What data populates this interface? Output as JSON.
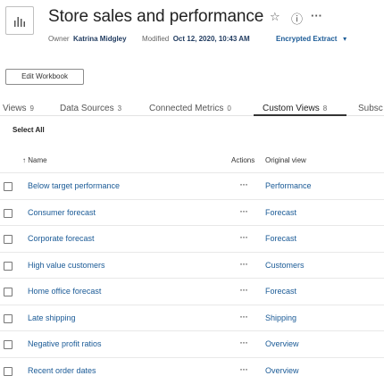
{
  "header": {
    "title": "Store sales and performance",
    "owner_label": "Owner",
    "owner": "Katrina Midgley",
    "modified_label": "Modified",
    "modified": "Oct 12, 2020, 10:43 AM",
    "extract": "Encrypted Extract",
    "favorite_glyph": "☆",
    "info_glyph": "ⓘ",
    "more_glyph": "···",
    "dropdown_glyph": "▾"
  },
  "toolbar": {
    "edit_label": "Edit Workbook"
  },
  "tabs": [
    {
      "label": "Views",
      "count": "9"
    },
    {
      "label": "Data Sources",
      "count": "3"
    },
    {
      "label": "Connected Metrics",
      "count": "0"
    },
    {
      "label": "Custom Views",
      "count": "8"
    },
    {
      "label": "Subsc",
      "count": ""
    }
  ],
  "active_tab": "Custom Views",
  "list": {
    "select_all": "Select All",
    "columns": {
      "name": "↑ Name",
      "actions": "Actions",
      "original_view": "Original view"
    },
    "actions_glyph": "···",
    "rows": [
      {
        "name": "Below target performance",
        "view": "Performance"
      },
      {
        "name": "Consumer forecast",
        "view": "Forecast"
      },
      {
        "name": "Corporate forecast",
        "view": "Forecast"
      },
      {
        "name": "High value customers",
        "view": "Customers"
      },
      {
        "name": "Home office forecast",
        "view": "Forecast"
      },
      {
        "name": "Late shipping",
        "view": "Shipping"
      },
      {
        "name": "Negative profit ratios",
        "view": "Overview"
      },
      {
        "name": "Recent order dates",
        "view": "Overview"
      }
    ]
  },
  "colors": {
    "link": "#1a5a96",
    "text": "#333333",
    "divider": "#e8e8e8"
  }
}
